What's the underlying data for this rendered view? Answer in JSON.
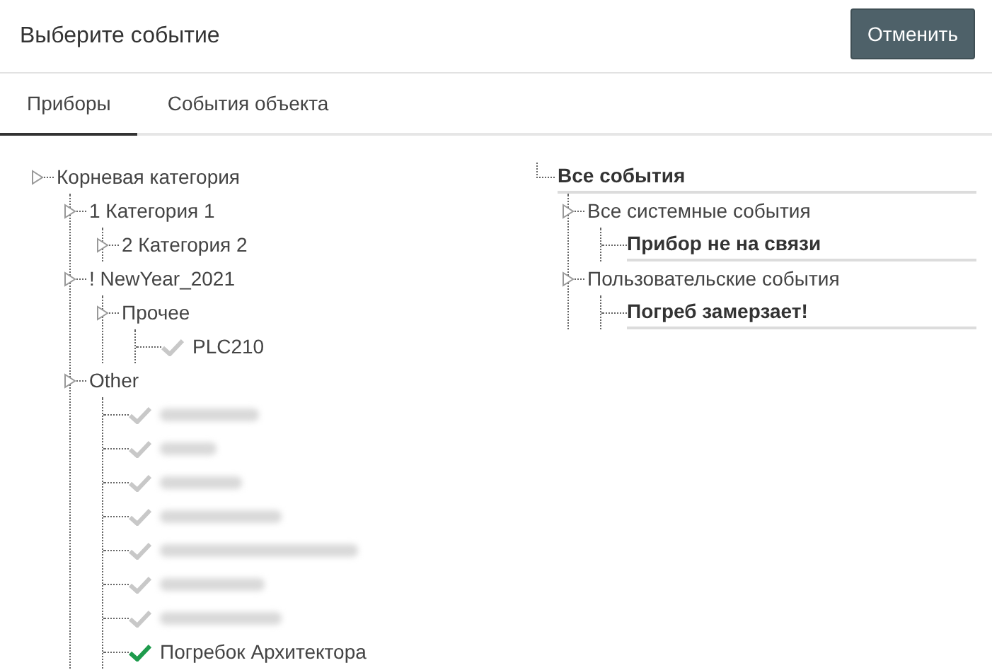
{
  "dialog": {
    "title": "Выберите событие",
    "cancel_button": "Отменить"
  },
  "tabs": [
    {
      "label": "Приборы",
      "selected": true
    },
    {
      "label": "События объекта",
      "selected": false
    }
  ],
  "device_tree": [
    {
      "kind": "category",
      "label": "Корневая категория",
      "children": [
        {
          "kind": "category",
          "label": "1 Категория 1",
          "children": [
            {
              "kind": "category",
              "label": "2 Категория 2"
            }
          ]
        },
        {
          "kind": "category",
          "label": "! NewYear_2021",
          "children": [
            {
              "kind": "category",
              "label": "Прочее",
              "children": [
                {
                  "kind": "device",
                  "label": "PLC210",
                  "checked": false
                }
              ]
            }
          ]
        },
        {
          "kind": "category",
          "label": "Other",
          "children": [
            {
              "kind": "device",
              "blurred": true,
              "checked": false
            },
            {
              "kind": "device",
              "blurred": true,
              "checked": false
            },
            {
              "kind": "device",
              "blurred": true,
              "checked": false
            },
            {
              "kind": "device",
              "blurred": true,
              "checked": false
            },
            {
              "kind": "device",
              "blurred": true,
              "checked": false
            },
            {
              "kind": "device",
              "blurred": true,
              "checked": false
            },
            {
              "kind": "device",
              "blurred": true,
              "checked": false
            },
            {
              "kind": "device",
              "label": "Погребок Архитектора",
              "checked": true
            }
          ]
        }
      ]
    }
  ],
  "event_tree": [
    {
      "kind": "event",
      "label": "Все события",
      "children": [
        {
          "kind": "group",
          "label": "Все системные события",
          "children": [
            {
              "kind": "event",
              "label": "Прибор не на связи"
            }
          ]
        },
        {
          "kind": "group",
          "label": "Пользовательские события",
          "children": [
            {
              "kind": "event",
              "label": "Погреб замерзает!"
            }
          ]
        }
      ]
    }
  ]
}
